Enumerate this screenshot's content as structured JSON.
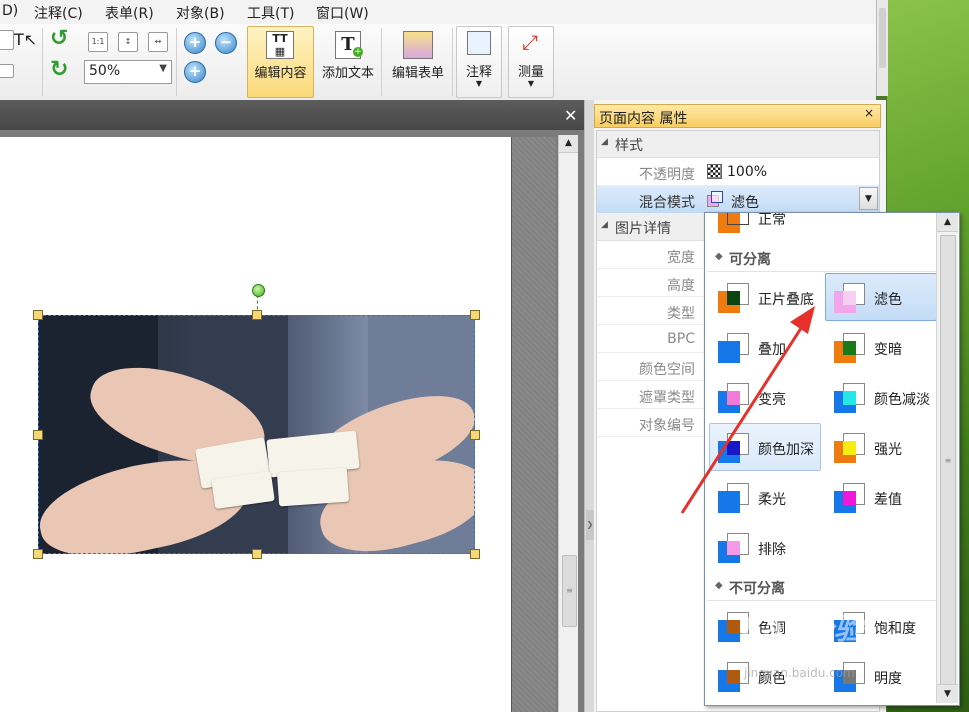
{
  "menu": [
    "D)",
    "注释(C)",
    "表单(R)",
    "对象(B)",
    "工具(T)",
    "窗口(W)"
  ],
  "toolbar": {
    "zoom": "50%",
    "edit_content": "编辑内容",
    "add_text": "添加文本",
    "edit_form": "编辑表单",
    "annotate": "注释",
    "measure": "测量",
    "small_btn_1": "1:1"
  },
  "panel": {
    "title": "页面内容 属性",
    "close": "×",
    "cat_style": "样式",
    "opacity_label": "不透明度",
    "opacity_value": "100%",
    "blend_label": "混合模式",
    "blend_value": "滤色",
    "cat_image": "图片详情",
    "fields": [
      "宽度",
      "高度",
      "类型",
      "BPC",
      "颜色空间",
      "遮罩类型",
      "对象编号"
    ]
  },
  "dropdown": {
    "partial_top": "正常",
    "cat_separable": "可分离",
    "cat_nonseparable": "不可分离",
    "separable": [
      {
        "label": "正片叠底",
        "a": "#ee7a10",
        "c": "#0b4411"
      },
      {
        "label": "滤色",
        "a": "#f3a6ec",
        "c": "#f7cff2"
      },
      {
        "label": "叠加",
        "a": "#1677e8",
        "c": "#1677e8"
      },
      {
        "label": "变暗",
        "a": "#ee7a10",
        "c": "#1a7a1a"
      },
      {
        "label": "变亮",
        "a": "#1677e8",
        "c": "#f07ad8"
      },
      {
        "label": "颜色减淡",
        "a": "#1677e8",
        "c": "#27e6e6"
      },
      {
        "label": "颜色加深",
        "a": "#1677e8",
        "c": "#1818c8"
      },
      {
        "label": "强光",
        "a": "#ee7a10",
        "c": "#f6ee10"
      },
      {
        "label": "柔光",
        "a": "#1677e8",
        "c": "#1677e8"
      },
      {
        "label": "差值",
        "a": "#1677e8",
        "c": "#f018d8"
      },
      {
        "label": "排除",
        "a": "#1677e8",
        "c": "#f59ae8"
      }
    ],
    "nonseparable": [
      {
        "label": "色调",
        "a": "#1677e8",
        "c": "#b05a10"
      },
      {
        "label": "饱和度",
        "a": "#1677e8",
        "c": "#1677e8"
      },
      {
        "label": "颜色",
        "a": "#1677e8",
        "c": "#b05a10"
      },
      {
        "label": "明度",
        "a": "#1677e8",
        "c": "#777777"
      }
    ]
  },
  "watermark": "Bai 经验",
  "watermark_url": "jingyan.baidu.com",
  "colors": {
    "accent": "#f7cd62",
    "arrow": "#e8302a",
    "selection": "#2b76d2"
  }
}
